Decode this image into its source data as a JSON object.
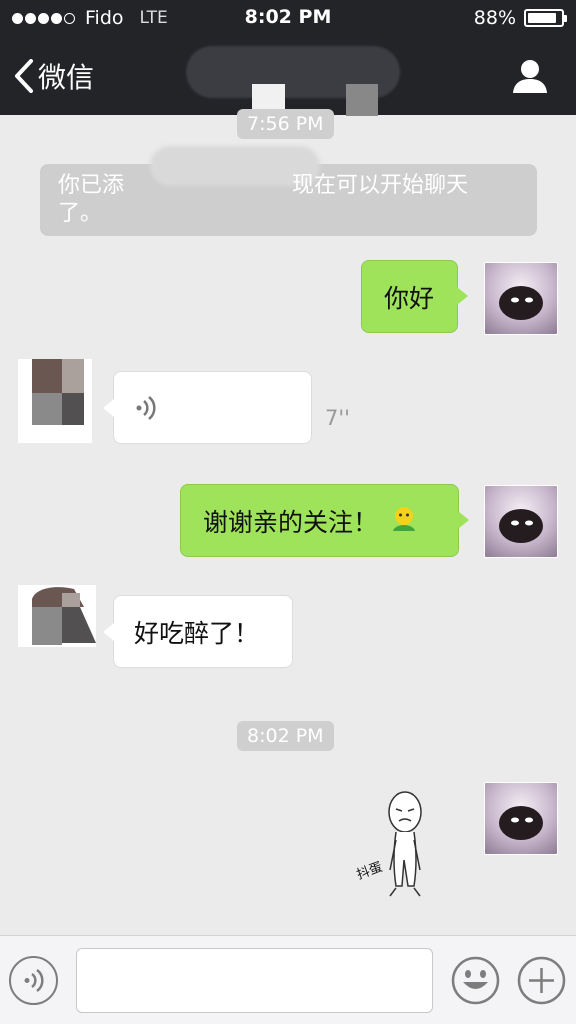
{
  "status_bar": {
    "carrier": "Fido",
    "network": "LTE",
    "time": "8:02 PM",
    "battery": "88%",
    "battery_level": 0.88
  },
  "nav": {
    "back_label": "微信",
    "back_icon": "chevron-left-icon",
    "contact_icon": "person-icon"
  },
  "chat": {
    "timestamp_1": "7:56 PM",
    "system_line_1a": "你已添",
    "system_line_1b": "现在可以开始聊天",
    "system_line_2": "了。",
    "msg_hello": "你好",
    "voice_duration": "7''",
    "msg_thanks": "谢谢亲的关注！",
    "msg_reply": "好吃醉了！",
    "timestamp_2": "8:02 PM",
    "sticker_text": "抖蛋"
  },
  "input_bar": {
    "text_value": "",
    "voice_icon": "voice-icon",
    "emoji_icon": "smiley-icon",
    "plus_icon": "plus-icon"
  },
  "colors": {
    "header_bg": "#232428",
    "chat_bg": "#ebebeb",
    "bubble_me": "#9fe35b",
    "bubble_other": "#ffffff"
  }
}
